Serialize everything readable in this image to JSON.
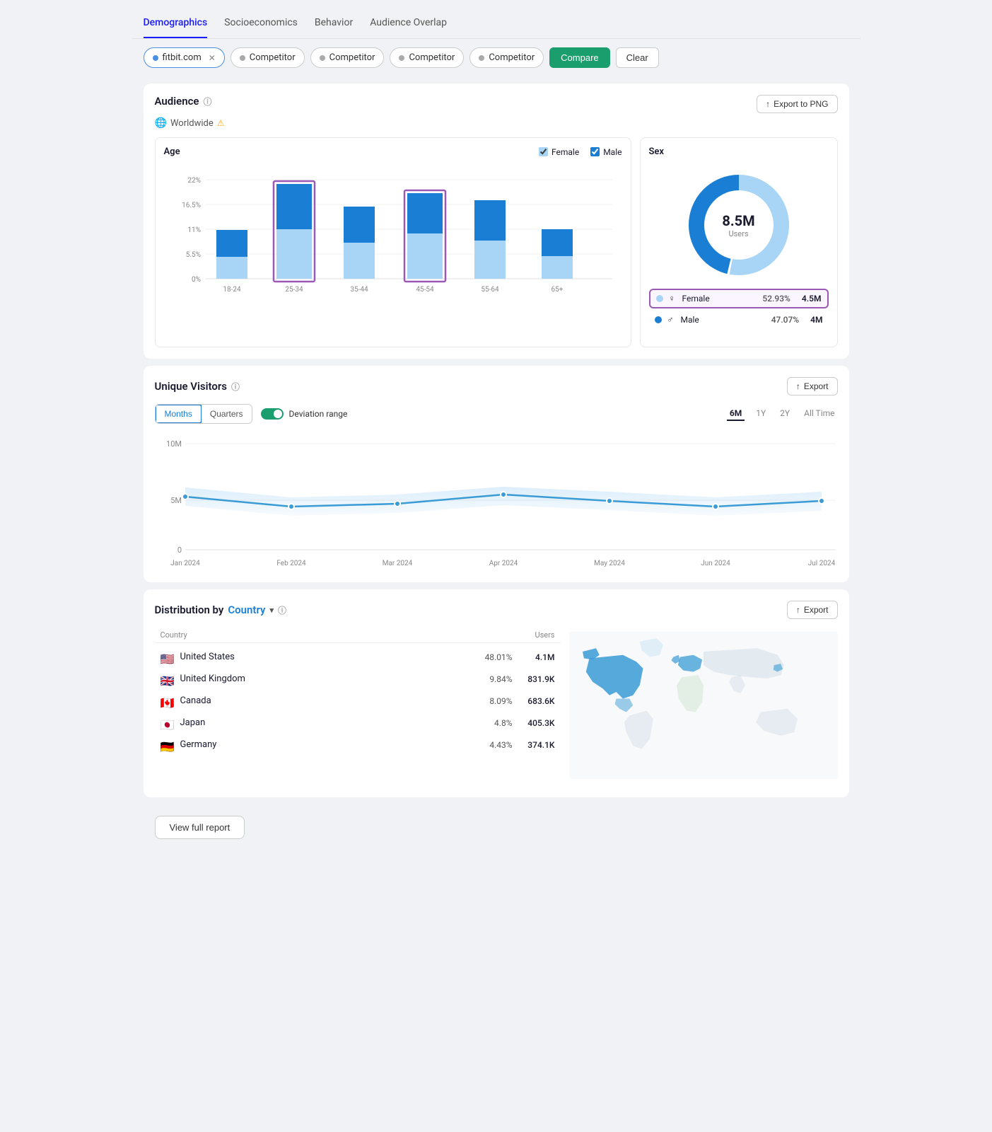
{
  "nav": {
    "tabs": [
      {
        "label": "Demographics",
        "active": true
      },
      {
        "label": "Socioeconomics",
        "active": false
      },
      {
        "label": "Behavior",
        "active": false
      },
      {
        "label": "Audience Overlap",
        "active": false
      }
    ]
  },
  "searchbar": {
    "chips": [
      {
        "label": "fitbit.com",
        "active": true,
        "hasX": true
      },
      {
        "label": "Competitor",
        "active": false,
        "hasX": false
      },
      {
        "label": "Competitor",
        "active": false,
        "hasX": false
      },
      {
        "label": "Competitor",
        "active": false,
        "hasX": false
      },
      {
        "label": "Competitor",
        "active": false,
        "hasX": false
      }
    ],
    "compare_label": "Compare",
    "clear_label": "Clear"
  },
  "audience": {
    "title": "Audience",
    "worldwide": "Worldwide",
    "export_label": "Export to PNG",
    "age_title": "Age",
    "sex_title": "Sex",
    "legend_female": "Female",
    "legend_male": "Male",
    "age_bars": [
      {
        "group": "18-24",
        "female": 5,
        "male": 6,
        "highlight": false
      },
      {
        "group": "25-34",
        "female": 11,
        "male": 10,
        "highlight": true
      },
      {
        "group": "35-44",
        "female": 8,
        "male": 8,
        "highlight": false
      },
      {
        "group": "45-54",
        "female": 10,
        "male": 9,
        "highlight": true
      },
      {
        "group": "55-64",
        "female": 8.5,
        "male": 9,
        "highlight": false
      },
      {
        "group": "65+",
        "female": 5,
        "male": 6,
        "highlight": false
      }
    ],
    "y_labels": [
      "22%",
      "16.5%",
      "11%",
      "5.5%",
      "0%"
    ],
    "donut_total": "8.5M",
    "donut_sub": "Users",
    "sex_rows": [
      {
        "gender": "Female",
        "symbol": "♀",
        "pct": "52.93%",
        "count": "4.5M",
        "highlight": true,
        "dot": "female"
      },
      {
        "gender": "Male",
        "symbol": "♂",
        "pct": "47.07%",
        "count": "4M",
        "highlight": false,
        "dot": "male"
      }
    ]
  },
  "unique_visitors": {
    "title": "Unique Visitors",
    "export_label": "Export",
    "toggle_months": "Months",
    "toggle_quarters": "Quarters",
    "deviation_label": "Deviation range",
    "time_ranges": [
      "6M",
      "1Y",
      "2Y",
      "All Time"
    ],
    "active_range": "6M",
    "y_labels": [
      "10M",
      "5M",
      "0"
    ],
    "x_labels": [
      "Jan 2024",
      "Feb 2024",
      "Mar 2024",
      "Apr 2024",
      "May 2024",
      "Jun 2024",
      "Jul 2024"
    ],
    "data_points": [
      {
        "x": 0,
        "y": 5.0
      },
      {
        "x": 1,
        "y": 4.7
      },
      {
        "x": 2,
        "y": 4.8
      },
      {
        "x": 3,
        "y": 5.1
      },
      {
        "x": 4,
        "y": 4.9
      },
      {
        "x": 5,
        "y": 4.7
      },
      {
        "x": 6,
        "y": 4.9
      }
    ]
  },
  "distribution": {
    "title": "Distribution by",
    "country_label": "Country",
    "col_country": "Country",
    "col_users": "Users",
    "export_label": "Export",
    "rows": [
      {
        "flag": "🇺🇸",
        "name": "United States",
        "pct": "48.01%",
        "users": "4.1M"
      },
      {
        "flag": "🇬🇧",
        "name": "United Kingdom",
        "pct": "9.84%",
        "users": "831.9K"
      },
      {
        "flag": "🇨🇦",
        "name": "Canada",
        "pct": "8.09%",
        "users": "683.6K"
      },
      {
        "flag": "🇯🇵",
        "name": "Japan",
        "pct": "4.8%",
        "users": "405.3K"
      },
      {
        "flag": "🇩🇪",
        "name": "Germany",
        "pct": "4.43%",
        "users": "374.1K"
      }
    ]
  },
  "footer": {
    "view_report": "View full report"
  }
}
